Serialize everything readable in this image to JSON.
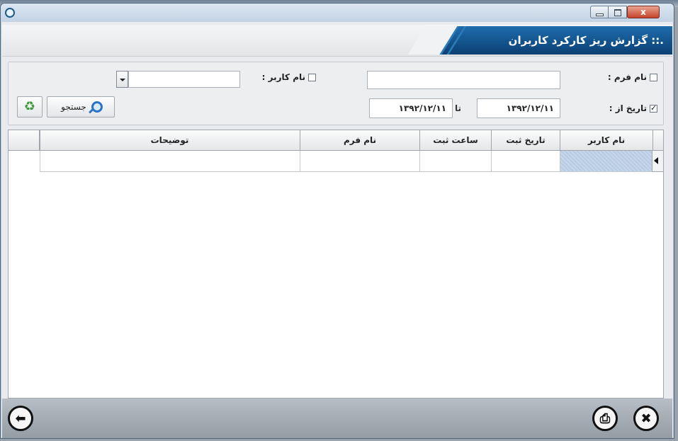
{
  "window": {
    "title": "",
    "close_glyph": "x"
  },
  "header": {
    "title": ".:: گزارش ریز کارکرد کاربران"
  },
  "filters": {
    "form_name": {
      "label": "نام فرم :",
      "checked": false,
      "value": ""
    },
    "user_name": {
      "label": "نام کاربر :",
      "checked": false,
      "value": ""
    },
    "date_from": {
      "label": "تاریخ از :",
      "checked": true,
      "value": "۱۳۹۲/۱۲/۱۱"
    },
    "date_to": {
      "separator": "تا",
      "value": "۱۳۹۲/۱۲/۱۱"
    },
    "search_button": {
      "label": "جستجو",
      "icon": "magnifier-icon"
    },
    "refresh_button": {
      "icon": "recycle-icon"
    }
  },
  "grid": {
    "columns": [
      "نام کاربر",
      "تاریخ ثبت",
      "ساعت ثبت",
      "نام فرم",
      "توضیحات"
    ],
    "rows": [
      [
        "",
        "",
        "",
        "",
        ""
      ]
    ]
  },
  "footer": {
    "buttons": [
      {
        "name": "close",
        "icon": "close-circle-icon",
        "glyph": "✖"
      },
      {
        "name": "print",
        "icon": "printer-icon",
        "glyph": "⎙"
      },
      {
        "name": "back",
        "icon": "arrow-left-circle-icon",
        "glyph": "⬅"
      }
    ]
  },
  "colors": {
    "header_banner": "#0b3f73",
    "title_text": "#ffffff",
    "selection": "#c6d7ec"
  }
}
